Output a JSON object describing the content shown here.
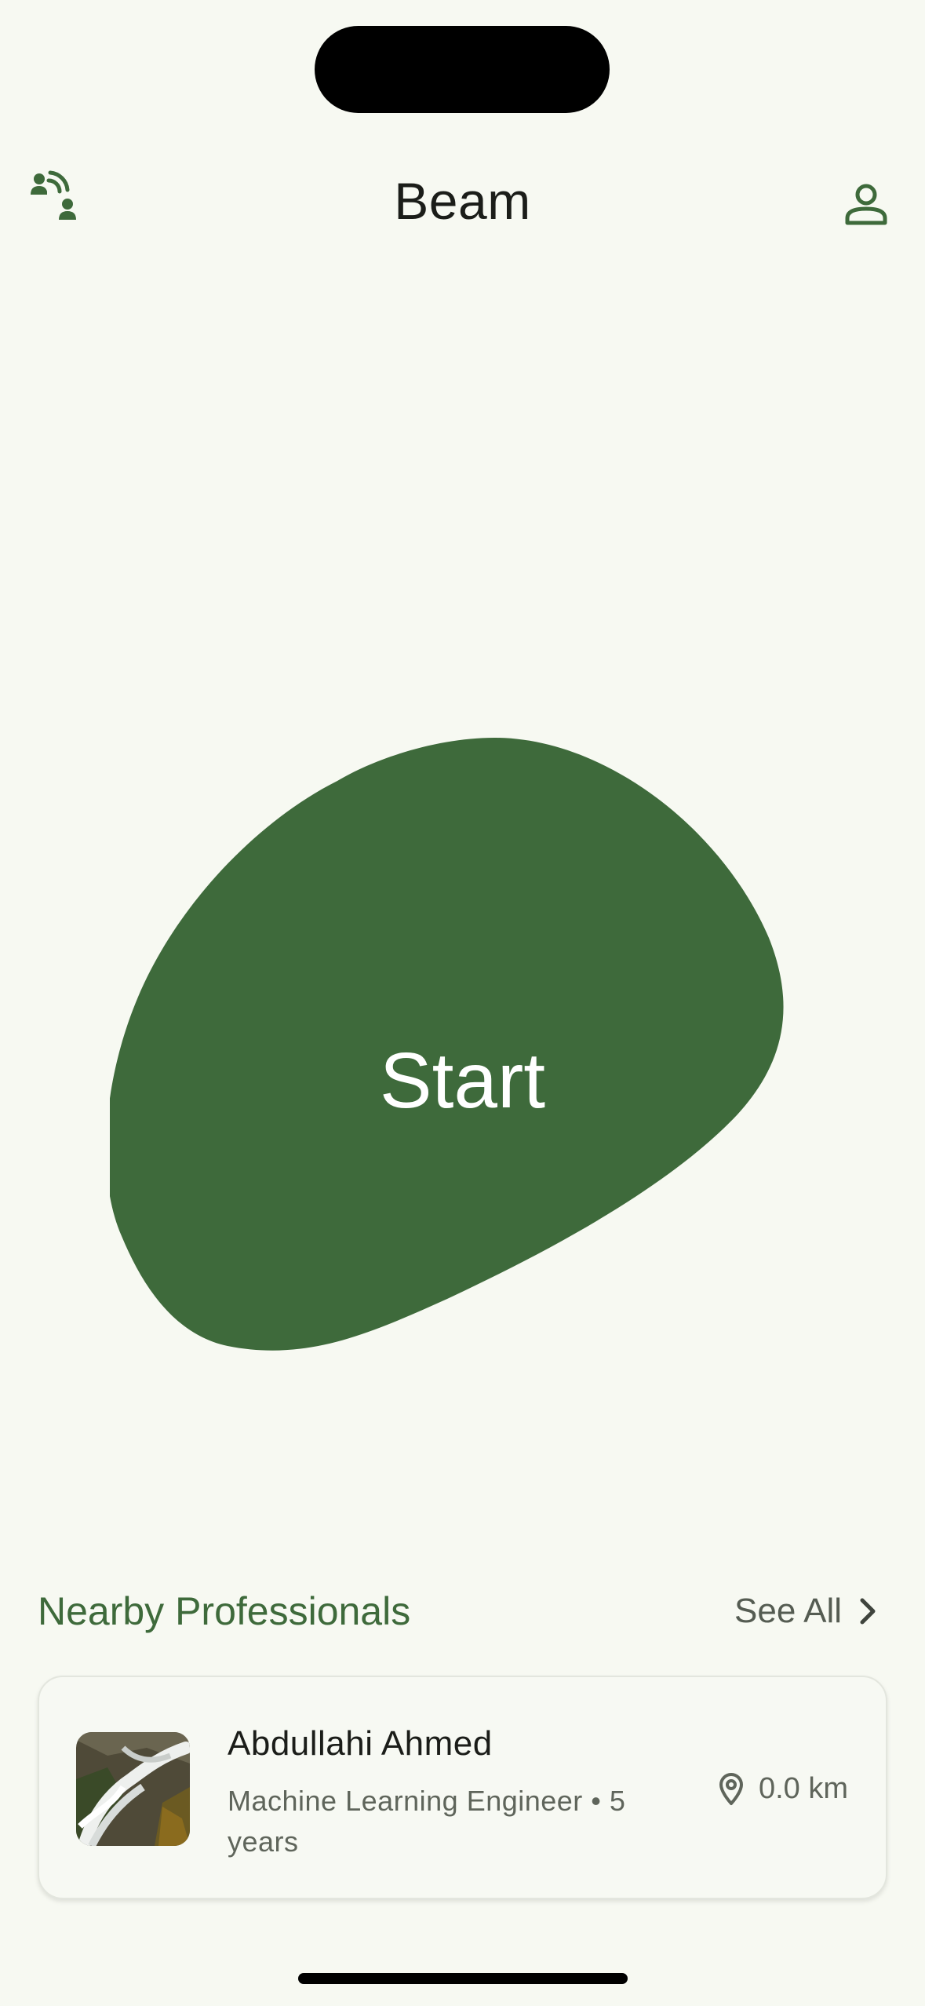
{
  "app": {
    "title": "Beam"
  },
  "header": {
    "left_icon": "connect-people-icon",
    "right_icon": "person-icon"
  },
  "main": {
    "start_label": "Start",
    "blob_color": "#3e6a3b"
  },
  "nearby": {
    "title": "Nearby Professionals",
    "see_all_label": "See All",
    "items": [
      {
        "name": "Abdullahi Ahmed",
        "subtitle": "Machine Learning Engineer • 5 years",
        "distance": "0.0 km",
        "avatar_icon": "waterfall-photo"
      }
    ]
  },
  "colors": {
    "accent": "#3e6a3b",
    "background": "#f7f9f2",
    "text": "#1b1d19",
    "muted": "#5f655b"
  }
}
